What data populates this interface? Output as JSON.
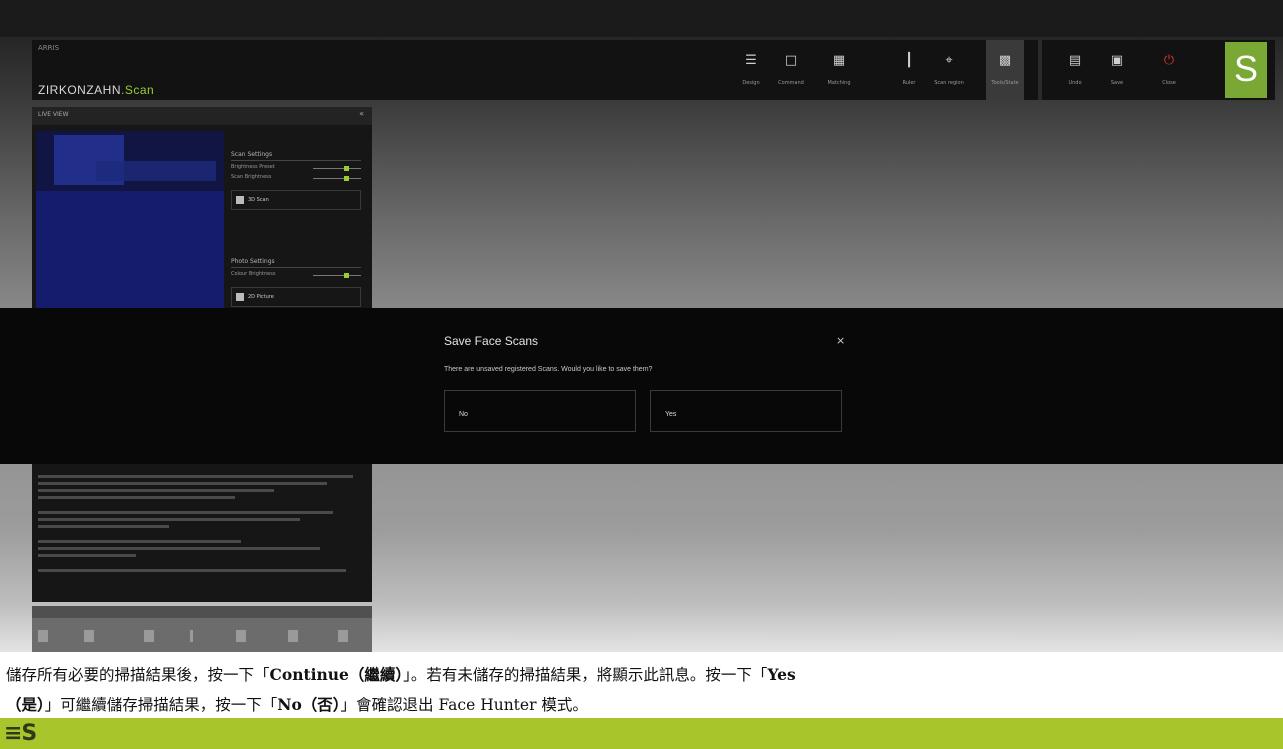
{
  "app": {
    "small_label": "ARRIS",
    "brand_prefix": "ZIRKONZAHN",
    "brand_suffix": ".Scan",
    "toolbar": [
      {
        "label": "Design",
        "icon": "menu-icon"
      },
      {
        "label": "Command",
        "icon": "monitor-icon"
      },
      {
        "label": "Matching",
        "icon": "document-icon"
      },
      {
        "label": "Ruler",
        "icon": "ruler-icon"
      },
      {
        "label": "Scan region",
        "icon": "crop-icon"
      },
      {
        "label": "Tools/State",
        "icon": "grid-icon",
        "active": true
      }
    ],
    "toolbar2": [
      {
        "label": "Undo",
        "icon": "keyboard-icon"
      },
      {
        "label": "Save",
        "icon": "save-icon"
      },
      {
        "label": "Close",
        "icon": "power-icon"
      }
    ],
    "logo_letter": "S"
  },
  "live_panel": {
    "title": "LIVE VIEW",
    "collapse": "«",
    "scan_settings": {
      "header": "Scan Settings",
      "rows": [
        "Brightness Preset",
        "Scan Brightness"
      ],
      "button": "3D Scan"
    },
    "photo_settings": {
      "header": "Photo Settings",
      "rows": [
        "Colour Brightness"
      ],
      "button": "2D Picture"
    }
  },
  "dialog": {
    "title": "Save Face Scans",
    "close": "×",
    "message": "There are unsaved registered Scans. Would you like to save them?",
    "no_label": "No",
    "yes_label": "Yes"
  },
  "caption": {
    "line1_a": "儲存所有必要的掃描結果後，按一下「",
    "line1_b": "Continue（繼續）",
    "line1_c": "」。若有未儲存的掃描結果，將顯示此訊息。按一下「",
    "line1_d": "Yes",
    "line2_a": "（是）",
    "line2_b": "」可繼續儲存掃描結果，按一下「",
    "line2_c": "No（否）",
    "line2_d": "」會確認退出 Face Hunter 模式。"
  },
  "footer": {
    "logo": "≡S"
  },
  "colors": {
    "accent": "#9acd32",
    "footer": "#a8c62c",
    "dialog_bg": "#080808"
  }
}
